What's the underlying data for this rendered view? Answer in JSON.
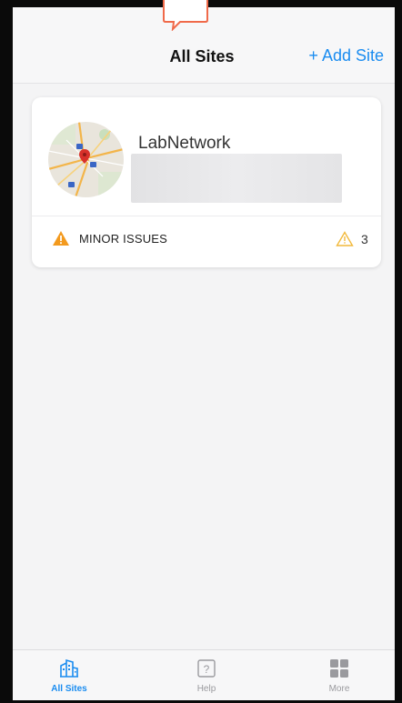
{
  "header": {
    "title": "All Sites",
    "add_site_label": "+ Add Site"
  },
  "site_card": {
    "name": "LabNetwork",
    "status_label": "MINOR ISSUES",
    "issue_count": "3"
  },
  "tabbar": {
    "items": [
      {
        "label": "All Sites",
        "icon": "buildings-icon",
        "active": true
      },
      {
        "label": "Help",
        "icon": "help-icon",
        "active": false
      },
      {
        "label": "More",
        "icon": "grid-icon",
        "active": false
      }
    ]
  },
  "colors": {
    "accent": "#1a8cf0",
    "warning": "#f39a1e",
    "background": "#f4f4f5"
  }
}
